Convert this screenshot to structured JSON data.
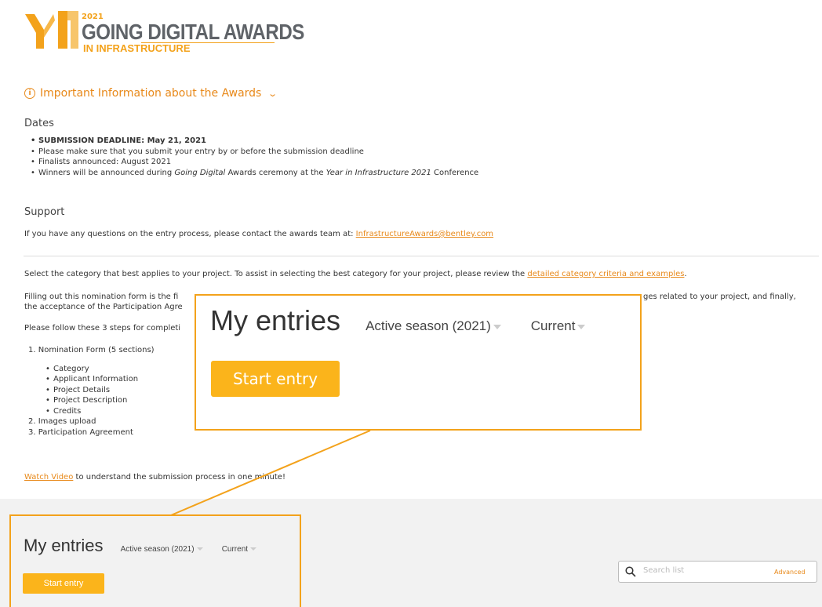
{
  "logo": {
    "year": "2021",
    "title": "GOING DIGITAL AWARDS",
    "subtitle": "IN INFRASTRUCTURE"
  },
  "info": {
    "label": "Important Information about the Awards"
  },
  "dates": {
    "heading": "Dates",
    "items": [
      "SUBMISSION DEADLINE: May 21, 2021",
      "Please make sure that you submit your entry by or before the submission deadline",
      "Finalists announced: August 2021"
    ],
    "winners": {
      "a": "Winners will be announced during ",
      "b": "Going Digital",
      "c": " Awards ceremony at the ",
      "d": "Year in Infrastructure 2021",
      "e": " Conference"
    }
  },
  "support": {
    "heading": "Support",
    "text": "If you have any questions on the entry process, please contact the awards team at: ",
    "email": "InfrastructureAwards@bentley.com"
  },
  "select": {
    "text": "Select the category that best applies to your project. To assist in selecting the best category for your project, please review the ",
    "link": "detailed category criteria and examples",
    "end": "."
  },
  "filling": {
    "line1_left": "Filling out this nomination form is the fi",
    "line1_right": "ges related to your project, and finally,",
    "line2_left": "the acceptance of the Participation Agre"
  },
  "steps_intro": "Please follow these 3 steps for completi",
  "steps": {
    "one": "1. Nomination Form (5 sections)",
    "sub": [
      "Category",
      "Applicant Information",
      "Project Details",
      "Project Description",
      "Credits"
    ],
    "two": "2. Images upload",
    "three": "3. Participation Agreement"
  },
  "video": {
    "link": "Watch Video",
    "text": " to understand the submission process in one minute!"
  },
  "entries": {
    "title": "My entries",
    "season": "Active season (2021)",
    "filter": "Current",
    "start": "Start entry"
  },
  "search": {
    "placeholder": "Search list",
    "advanced": "Advanced"
  },
  "colors": {
    "accent": "#f3a21b",
    "button": "#fbb41b",
    "link": "#e8891a"
  }
}
